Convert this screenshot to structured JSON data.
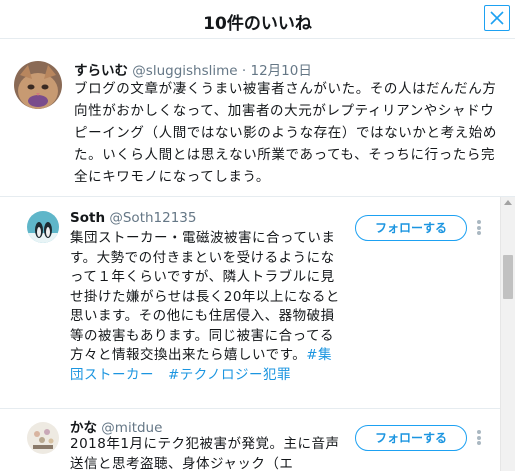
{
  "modal": {
    "title": "10件のいいね",
    "close_icon": "close-icon"
  },
  "tweet": {
    "author_name": "すらいむ",
    "author_handle": "@sluggishslime",
    "separator": "·",
    "date": "12月10日",
    "text": "ブログの文章が凄くうまい被害者さんがいた。その人はだんだん方向性がおかしくなって、加害者の大元がレプティリアンやシャドウピーイング（人間ではない影のような存在）ではないかと考え始めた。いくら人間とは思えない所業であっても、そっちに行ったら完全にキワモノになってしまう。"
  },
  "users": [
    {
      "name": "Soth",
      "handle": "@Soth12135",
      "bio_text": "集団ストーカー・電磁波被害に合っています。大勢での付きまといを受けるようになって１年くらいですが、隣人トラブルに見せ掛けた嫌がらせは長く20年以上になると思います。その他にも住居侵入、器物破損等の被害もあります。同じ被害に合ってる方々と情報交換出来たら嬉しいです。",
      "bio_tags": "#集団ストーカー　#テクノロジー犯罪",
      "follow_label": "フォローする",
      "more_icon": "more-vertical-icon"
    },
    {
      "name": "かな",
      "handle": "@mitdue",
      "bio_text": "2018年1月にテク犯被害が発覚。主に音声送信と思考盗聴、身体ジャック（エ",
      "follow_label": "フォローする",
      "more_icon": "more-vertical-icon"
    }
  ],
  "colors": {
    "accent": "#1da1f2",
    "link": "#1b95e0",
    "text": "#14171a",
    "muted": "#657786",
    "border": "#e6ecf0"
  }
}
